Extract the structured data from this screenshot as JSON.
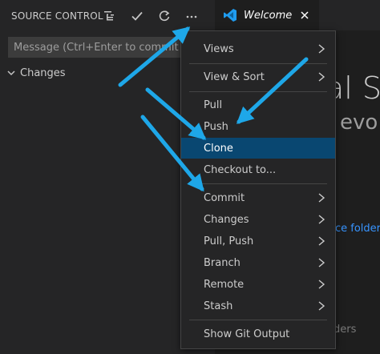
{
  "sidebar": {
    "title": "SOURCE CONTROL",
    "actions": {
      "view_tree_icon": "list-tree-icon",
      "commit_icon": "check-icon",
      "refresh_icon": "refresh-icon",
      "more_icon": "ellipsis-icon"
    },
    "commit_message_placeholder": "Message (Ctrl+Enter to commit on",
    "changes_label": "Changes"
  },
  "tab": {
    "label": "Welcome",
    "icon": "vscode-icon",
    "close_icon": "close-icon"
  },
  "welcome": {
    "title_fragment": "al St",
    "subtitle_fragment": "evo",
    "link_fragment": "ce folder.",
    "faded_fragment": "ders"
  },
  "menu": {
    "items": [
      {
        "label": "Views",
        "submenu": true
      },
      {
        "label": "View & Sort",
        "submenu": true
      },
      {
        "label": "Pull",
        "submenu": false
      },
      {
        "label": "Push",
        "submenu": false
      },
      {
        "label": "Clone",
        "submenu": false,
        "selected": true
      },
      {
        "label": "Checkout to...",
        "submenu": false
      },
      {
        "label": "Commit",
        "submenu": true
      },
      {
        "label": "Changes",
        "submenu": true
      },
      {
        "label": "Pull, Push",
        "submenu": true
      },
      {
        "label": "Branch",
        "submenu": true
      },
      {
        "label": "Remote",
        "submenu": true
      },
      {
        "label": "Stash",
        "submenu": true
      },
      {
        "label": "Show Git Output",
        "submenu": false
      }
    ]
  },
  "colors": {
    "accent": "#094771",
    "annotation_arrow": "#1ea7e8",
    "link": "#3794ff"
  }
}
